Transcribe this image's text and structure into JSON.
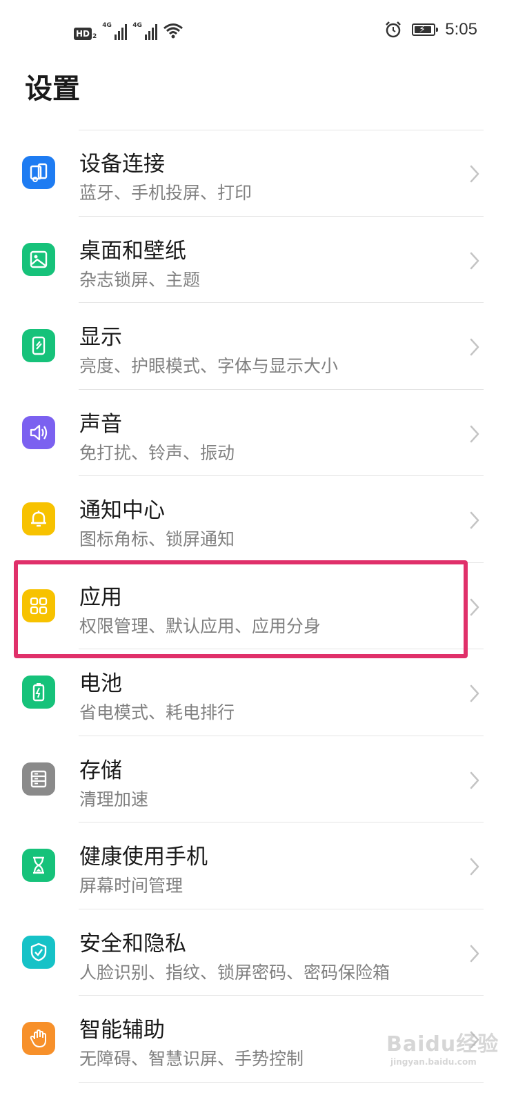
{
  "status_bar": {
    "hd_label": "HD",
    "hd_sim": "2",
    "sim1_tag": "4G",
    "sim2_tag": "4G",
    "time": "5:05"
  },
  "page_title": "设置",
  "settings": [
    {
      "title": "设备连接",
      "subtitle": "蓝牙、手机投屏、打印",
      "icon": "device-connection-icon",
      "color": "#1e7cf2"
    },
    {
      "title": "桌面和壁纸",
      "subtitle": "杂志锁屏、主题",
      "icon": "wallpaper-icon",
      "color": "#16c27a"
    },
    {
      "title": "显示",
      "subtitle": "亮度、护眼模式、字体与显示大小",
      "icon": "display-icon",
      "color": "#16c27a"
    },
    {
      "title": "声音",
      "subtitle": "免打扰、铃声、振动",
      "icon": "sound-icon",
      "color": "#7b61f0"
    },
    {
      "title": "通知中心",
      "subtitle": "图标角标、锁屏通知",
      "icon": "bell-icon",
      "color": "#f7c200"
    },
    {
      "title": "应用",
      "subtitle": "权限管理、默认应用、应用分身",
      "icon": "apps-grid-icon",
      "color": "#f7c200"
    },
    {
      "title": "电池",
      "subtitle": "省电模式、耗电排行",
      "icon": "battery-icon",
      "color": "#16c27a"
    },
    {
      "title": "存储",
      "subtitle": "清理加速",
      "icon": "storage-icon",
      "color": "#8a8a8a"
    },
    {
      "title": "健康使用手机",
      "subtitle": "屏幕时间管理",
      "icon": "hourglass-icon",
      "color": "#16c27a"
    },
    {
      "title": "安全和隐私",
      "subtitle": "人脸识别、指纹、锁屏密码、密码保险箱",
      "icon": "shield-icon",
      "color": "#16c2c7"
    },
    {
      "title": "智能辅助",
      "subtitle": "无障碍、智慧识屏、手势控制",
      "icon": "hand-icon",
      "color": "#f7902a"
    }
  ],
  "highlight_color": "#e0306a",
  "watermark": {
    "text": "Baidu经验",
    "sub": "jingyan.baidu.com"
  }
}
